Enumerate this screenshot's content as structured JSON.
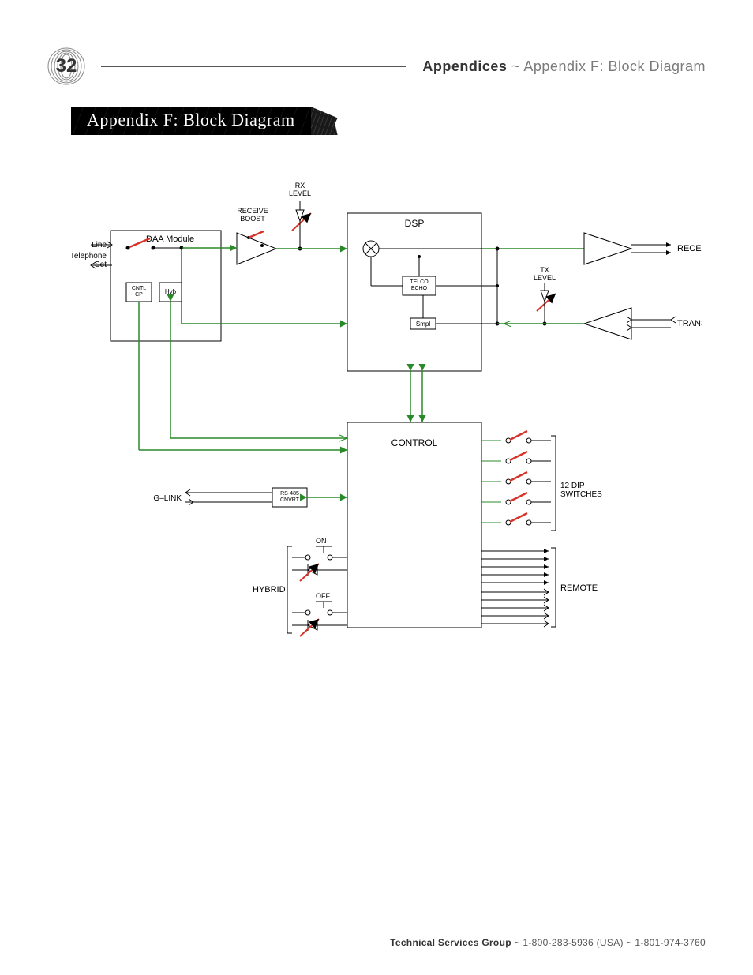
{
  "page_number": "32",
  "header": {
    "left_strong": "Appendices",
    "separator": " ~ ",
    "right_text": "Appendix F: Block Diagram"
  },
  "section_title": "Appendix F: Block Diagram",
  "diagram": {
    "labels": {
      "rx_level": "RX\nLEVEL",
      "receive_boost": "RECEIVE\nBOOST",
      "daa_module": "DAA  Module",
      "line": "Line",
      "telephone_set": "Telephone\nSet",
      "cntl_cp": "CNTL\nCP",
      "hyb": "Hyb",
      "dsp": "DSP",
      "telco_echo": "TELCO\nECHO",
      "smpl": "Smpl",
      "tx_level": "TX\nLEVEL",
      "receive": "RECEIVE",
      "transmit": "TRANSMIT",
      "control": "CONTROL",
      "rs485_cnvrt": "RS-485\nCNVRT",
      "g_link": "G–LINK",
      "hybrid": "HYBRID",
      "on": "ON",
      "off": "OFF",
      "dip_switches": "12  DIP\nSWITCHES",
      "remote": "REMOTE"
    }
  },
  "footer": {
    "group": "Technical Services Group",
    "sep": " ~ ",
    "phone1": "1-800-283-5936 (USA)",
    "phone2": "1-801-974-3760"
  }
}
